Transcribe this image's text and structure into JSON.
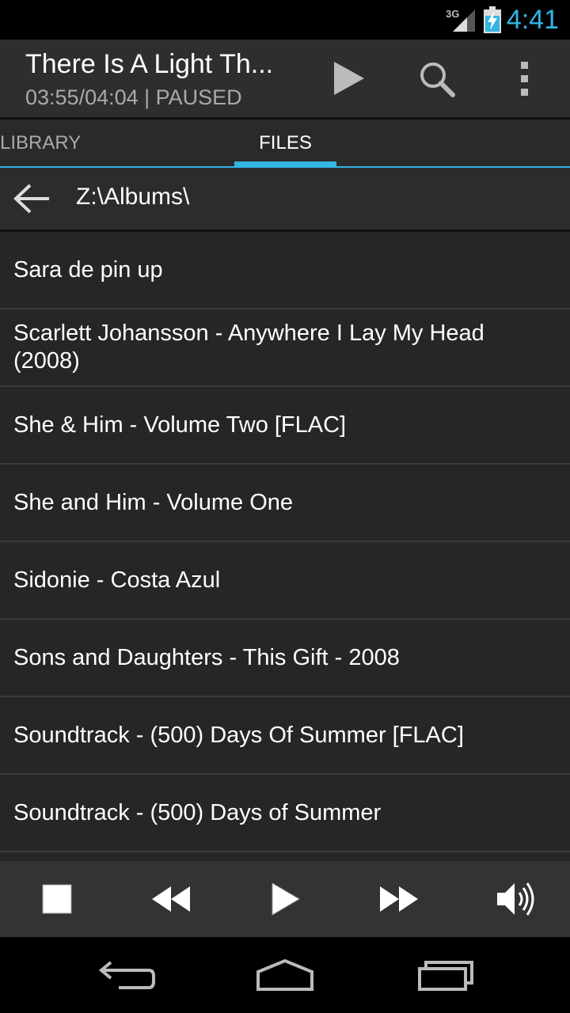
{
  "status_bar": {
    "network": "3G",
    "time": "4:41"
  },
  "now_playing": {
    "title": "There Is A Light Th...",
    "status": "03:55/04:04 | PAUSED"
  },
  "tabs": [
    {
      "label": "LIBRARY"
    },
    {
      "label": "FILES"
    }
  ],
  "path": "Z:\\Albums\\",
  "files": [
    {
      "name": "Sara de pin up"
    },
    {
      "name": "Scarlett Johansson - Anywhere I Lay My Head (2008)"
    },
    {
      "name": "She & Him - Volume Two [FLAC]"
    },
    {
      "name": "She and Him - Volume One"
    },
    {
      "name": "Sidonie - Costa Azul"
    },
    {
      "name": "Sons and Daughters - This Gift - 2008"
    },
    {
      "name": "Soundtrack - (500) Days Of Summer [FLAC]"
    },
    {
      "name": "Soundtrack - (500) Days of Summer"
    }
  ],
  "colors": {
    "accent": "#33b5e5"
  }
}
